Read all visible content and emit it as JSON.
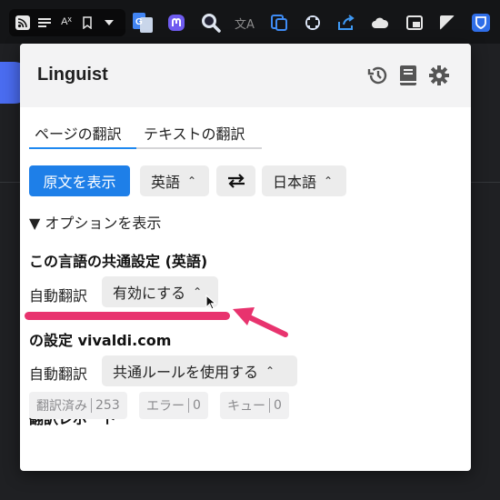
{
  "popup": {
    "title": "Linguist",
    "tabs": [
      {
        "label": "ページの翻訳",
        "active": true
      },
      {
        "label": "テキストの翻訳",
        "active": false
      }
    ],
    "show_original_label": "原文を表示",
    "source_language": "英語",
    "target_language": "日本語",
    "swap_icon": "swap-arrows-icon",
    "options_toggle": "▼ オプションを表示",
    "language_section": {
      "heading": "この言語の共通設定 (英語)",
      "auto_translate_label": "自動翻訳",
      "auto_translate_value": "有効にする"
    },
    "site_section": {
      "heading": "の設定 vivaldi.com",
      "auto_translate_label": "自動翻訳",
      "auto_translate_value": "共通ルールを使用する"
    },
    "report": {
      "heading": "翻訳レポート",
      "badges": [
        {
          "label": "翻訳済み",
          "count": "253"
        },
        {
          "label": "エラー",
          "count": "0"
        },
        {
          "label": "キュー",
          "count": "0"
        }
      ]
    }
  },
  "colors": {
    "accent": "#1e7fe8",
    "annotation": "#e8336e",
    "toolbar_bg": "#141517"
  }
}
